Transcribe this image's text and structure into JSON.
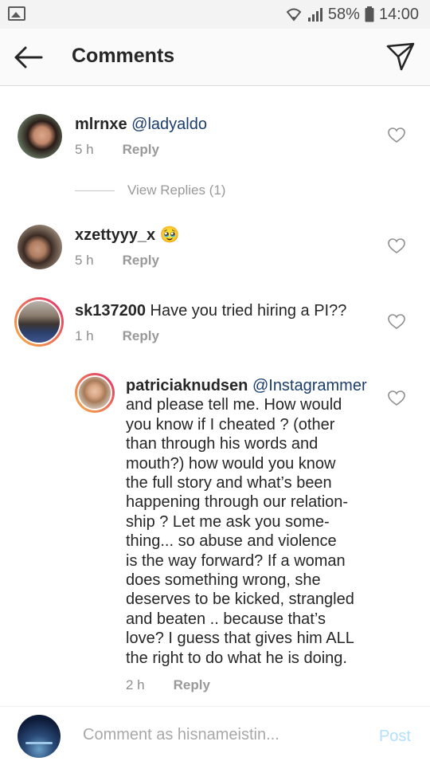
{
  "status_bar": {
    "battery": "58%",
    "time": "14:00",
    "icons": [
      "gallery-icon",
      "wifi-icon",
      "signal-icon",
      "battery-icon"
    ]
  },
  "header": {
    "title": "Comments",
    "back_icon": "arrow-left-icon",
    "send_icon": "paper-plane-icon"
  },
  "comments": [
    {
      "username": "mlrnxe",
      "mention": "@ladyaldo",
      "body": "",
      "time": "5 h",
      "reply_label": "Reply"
    },
    {
      "username": "xzettyyy_x",
      "mention": "",
      "body": "🥹",
      "time": "5 h",
      "reply_label": "Reply"
    },
    {
      "username": "sk137200",
      "mention": "",
      "body": "Have you tried hiring a PI??",
      "time": "1 h",
      "reply_label": "Reply"
    },
    {
      "username": "patriciaknudsen",
      "mention": "@Instagrammer",
      "lines": [
        "and please tell me. How would",
        "you know if I cheated ? (other",
        "than through his words and",
        "mouth?) how would you know",
        "the full story and what’s been",
        "happening through our relation-",
        "ship ? Let me ask you some-",
        "thing... so abuse and violence",
        "is the way forward? If a woman",
        "does something wrong, she",
        "deserves to be kicked, strangled",
        "and beaten .. because that’s",
        "love? I guess that gives him ALL",
        "the right to do what he is doing."
      ],
      "time": "2 h",
      "reply_label": "Reply"
    }
  ],
  "view_replies": "View Replies (1)",
  "footer": {
    "placeholder": "Comment as hisnameistin...",
    "post_label": "Post"
  },
  "colors": {
    "mention": "#1a3d6d",
    "post_disabled": "#b2dffc",
    "story_ring_start": "#f6b043",
    "story_ring_end": "#e1306c"
  }
}
